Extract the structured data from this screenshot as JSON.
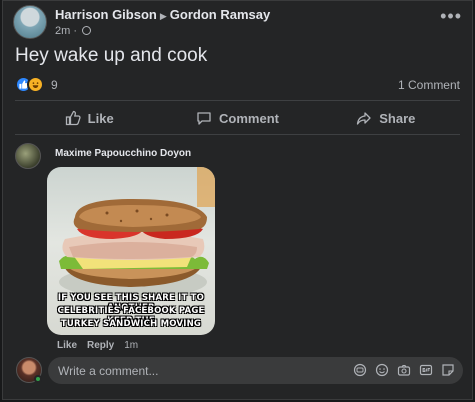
{
  "post": {
    "author": "Harrison Gibson",
    "target": "Gordon Ramsay",
    "time": "2m",
    "text": "Hey wake up and cook",
    "reaction_count": "9",
    "comment_count": "1 Comment"
  },
  "actions": {
    "like": "Like",
    "comment": "Comment",
    "share": "Share"
  },
  "comment": {
    "author": "Maxime Papoucchino Doyon",
    "meme_lines": [
      "IF YOU SEE THIS SHARE IT TO ANOTHER",
      "CELEBRITIES FACEBOOK PAGE KEEP THE",
      "TURKEY SANDWICH MOVING"
    ],
    "like": "Like",
    "reply": "Reply",
    "time": "1m"
  },
  "composer": {
    "placeholder": "Write a comment..."
  },
  "icons": {
    "more": "more-options-icon",
    "privacy": "globe-icon",
    "reactions": [
      "like-reaction-icon",
      "haha-reaction-icon"
    ],
    "composer": [
      "avatar-sticker-icon",
      "emoji-icon",
      "camera-icon",
      "gif-icon",
      "sticker-icon"
    ]
  },
  "colors": {
    "background": "#18191a",
    "card": "#242526",
    "accent": "#2d88ff",
    "text": "#e4e6eb",
    "muted": "#b0b3b8"
  }
}
